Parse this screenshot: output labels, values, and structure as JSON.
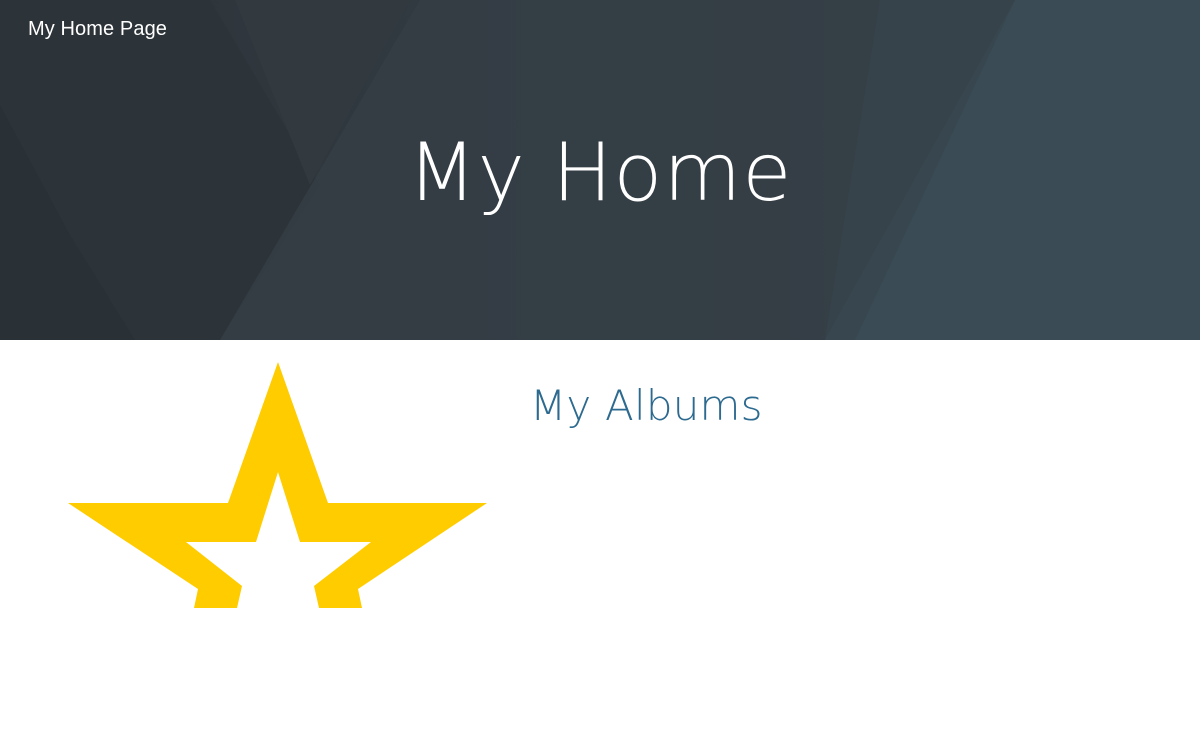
{
  "header": {
    "site_title": "My Home Page",
    "hero_title": "My Home"
  },
  "main": {
    "section_heading": "My Albums",
    "logo_icon": "star-icon"
  },
  "colors": {
    "hero_background": "#323b42",
    "hero_text": "#ffffff",
    "section_heading": "#2d6a8f",
    "star": "#ffcc00"
  }
}
